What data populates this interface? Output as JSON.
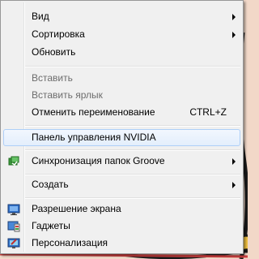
{
  "menu": {
    "items": [
      {
        "label": "Вид",
        "submenu": true
      },
      {
        "label": "Сортировка",
        "submenu": true
      },
      {
        "label": "Обновить"
      },
      {
        "label": "Вставить",
        "disabled": true
      },
      {
        "label": "Вставить ярлык",
        "disabled": true
      },
      {
        "label": "Отменить переименование",
        "shortcut": "CTRL+Z"
      },
      {
        "label": "Панель управления NVIDIA",
        "highlighted": true
      },
      {
        "label": "Синхронизация папок Groove",
        "submenu": true,
        "icon": "groove-sync-icon"
      },
      {
        "label": "Создать",
        "submenu": true
      },
      {
        "label": "Разрешение экрана",
        "icon": "screen-resolution-icon"
      },
      {
        "label": "Гаджеты",
        "icon": "gadgets-icon"
      },
      {
        "label": "Персонализация",
        "icon": "personalization-icon"
      }
    ]
  }
}
